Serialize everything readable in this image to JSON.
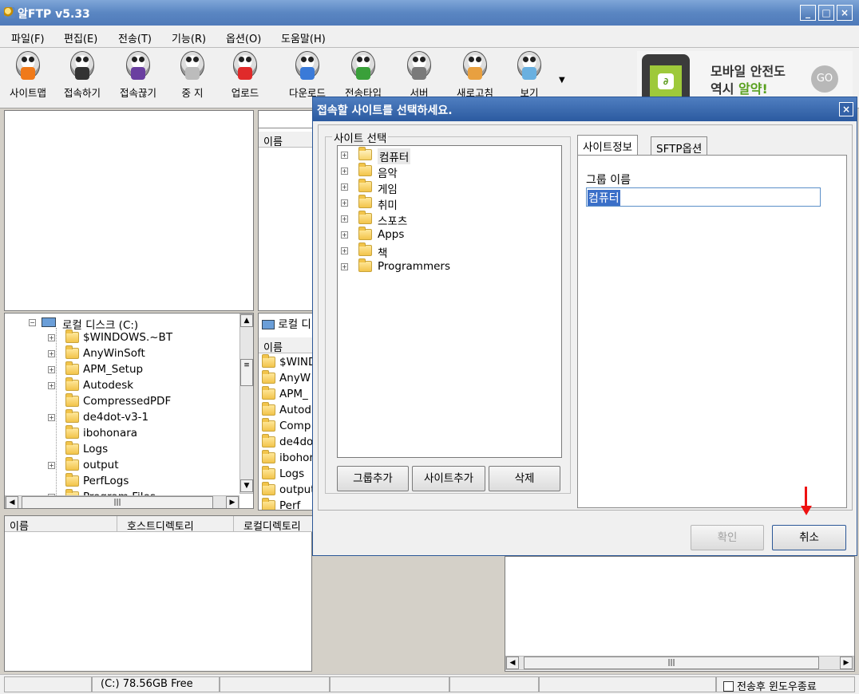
{
  "window": {
    "title": "알FTP v5.33",
    "minimize": "_",
    "maximize": "□",
    "close": "×"
  },
  "menu": [
    "파일(F)",
    "편집(E)",
    "전송(T)",
    "기능(R)",
    "옵션(O)",
    "도움말(H)"
  ],
  "toolbar": {
    "items": [
      {
        "label": "사이트맵",
        "icon": "sitemap-icon",
        "color": "#f07a1a"
      },
      {
        "label": "접속하기",
        "icon": "connect-icon",
        "color": "#333333"
      },
      {
        "label": "접속끊기",
        "icon": "disconnect-icon",
        "color": "#6a3fa0"
      },
      {
        "label": "중 지",
        "icon": "stop-icon",
        "color": "#bcbcbc"
      },
      {
        "label": "업로드",
        "icon": "upload-icon",
        "color": "#e02a2a"
      },
      {
        "label": "다운로드",
        "icon": "download-icon",
        "color": "#3a7ad8"
      },
      {
        "label": "전송타입",
        "icon": "transfer-type-icon",
        "color": "#3aa03a"
      },
      {
        "label": "서버",
        "icon": "server-icon",
        "color": "#7a7a7a"
      },
      {
        "label": "새로고침",
        "icon": "refresh-icon",
        "color": "#e8a040"
      },
      {
        "label": "보기",
        "icon": "view-icon",
        "color": "#6ab0e0"
      }
    ],
    "more": "▼"
  },
  "ad": {
    "line1": "모바일 안전도",
    "line2_prefix": "역시 ",
    "line2_highlight": "알약!",
    "go": "GO"
  },
  "local_tree": {
    "root": "로컬 디스크 (C:)",
    "items": [
      {
        "name": "$WINDOWS.~BT",
        "expand": true
      },
      {
        "name": "AnyWinSoft",
        "expand": true
      },
      {
        "name": "APM_Setup",
        "expand": true
      },
      {
        "name": "Autodesk",
        "expand": true
      },
      {
        "name": "CompressedPDF",
        "expand": false
      },
      {
        "name": "de4dot-v3-1",
        "expand": true
      },
      {
        "name": "ibohonara",
        "expand": false
      },
      {
        "name": "Logs",
        "expand": false
      },
      {
        "name": "output",
        "expand": true
      },
      {
        "name": "PerfLogs",
        "expand": false
      },
      {
        "name": "Program Files",
        "expand": true
      }
    ]
  },
  "remote_list": {
    "col_name": "이름"
  },
  "local_list": {
    "path": "로컬 디",
    "col_name": "이름",
    "items": [
      "$WIND",
      "AnyW",
      "APM_",
      "Autod",
      "Comp",
      "de4do",
      "ibohor",
      "Logs",
      "output",
      "Perf"
    ]
  },
  "queue": {
    "cols": [
      "이름",
      "호스트디렉토리",
      "로컬디렉토리"
    ]
  },
  "status": {
    "drive": "(C:)  78.56GB Free",
    "close_after": "전송후 윈도우종료"
  },
  "dialog": {
    "title": "접속할 사이트를 선택하세요.",
    "close": "×",
    "site_group": "사이트 선택",
    "tree": [
      "컴퓨터",
      "음악",
      "게임",
      "취미",
      "스포츠",
      "Apps",
      "책",
      "Programmers"
    ],
    "buttons": {
      "add_group": "그룹추가",
      "add_site": "사이트추가",
      "delete": "삭제"
    },
    "tabs": [
      "사이트정보",
      "SFTP옵션"
    ],
    "group_name_label": "그룹 이름",
    "group_name_value": "컴퓨터",
    "ok": "확인",
    "cancel": "취소"
  }
}
